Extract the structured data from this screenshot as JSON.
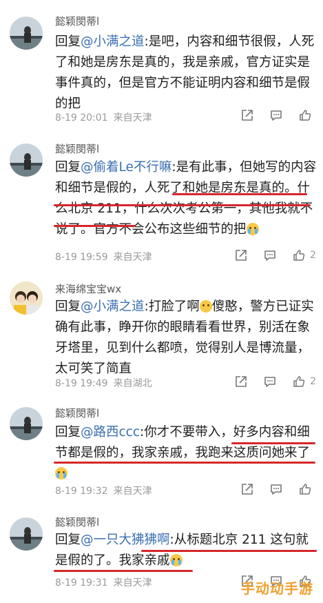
{
  "comments": [
    {
      "username": "懿颖閔蒂l",
      "parts": [
        {
          "t": "回复"
        },
        {
          "t": "@小满之道",
          "m": true
        },
        {
          "t": ":是吧，内容和细节很假，人死了和她是房东是真的，我是亲戚，官方证实是事件真的，但是官方不能证明内容和细节是假的把"
        }
      ],
      "time": "8-19 20:01",
      "location": "来自天津",
      "like_count": ""
    },
    {
      "username": "懿颖閔蒂l",
      "parts": [
        {
          "t": "回复"
        },
        {
          "t": "@偷着Le不行嘛",
          "m": true
        },
        {
          "t": ":是有此事，但她写的内容和细节是假的，人死了和她是房东是真的。什么北京 211，什么次次考公第一，其他我就不说了。官方不会公布这些细节的把"
        }
      ],
      "emoji": "cry",
      "time": "8-19 19:59",
      "location": "来自天津",
      "like_count": "2"
    },
    {
      "username": "来海绵宝宝wx",
      "parts": [
        {
          "t": "回复"
        },
        {
          "t": "@小满之道",
          "m": true
        },
        {
          "t": ":打脸了啊"
        },
        {
          "e": "smile"
        },
        {
          "t": "傻憨，警方已证实确有此事，睁开你的眼睛看看世界，别活在象牙塔里，见到什么都喷，觉得别人是博流量，太可笑了简直"
        }
      ],
      "time": "8-19 19:49",
      "location": "来自湖北",
      "like_count": "2"
    },
    {
      "username": "懿颖閔蒂l",
      "parts": [
        {
          "t": "回复"
        },
        {
          "t": "@路西ccc",
          "m": true
        },
        {
          "t": ":你才不要带入，好多内容和细节都是假的，我家亲戚，我跑来这质问她来了"
        }
      ],
      "emoji": "cry",
      "time": "8-19 19:32",
      "location": "来自天津",
      "like_count": ""
    },
    {
      "username": "懿颖閔蒂l",
      "parts": [
        {
          "t": "回复"
        },
        {
          "t": "@一只大狒狒啊",
          "m": true
        },
        {
          "t": ":从标题北京 211 这句就是假的了。我家亲戚"
        }
      ],
      "emoji": "cry",
      "time": "8-19 19:31",
      "location": "来自天津",
      "like_count": ""
    }
  ],
  "watermark": "手动动手游",
  "colors": {
    "mention": "#3a6fb0",
    "underline": "#d6262b",
    "meta": "#9a9a9a"
  }
}
